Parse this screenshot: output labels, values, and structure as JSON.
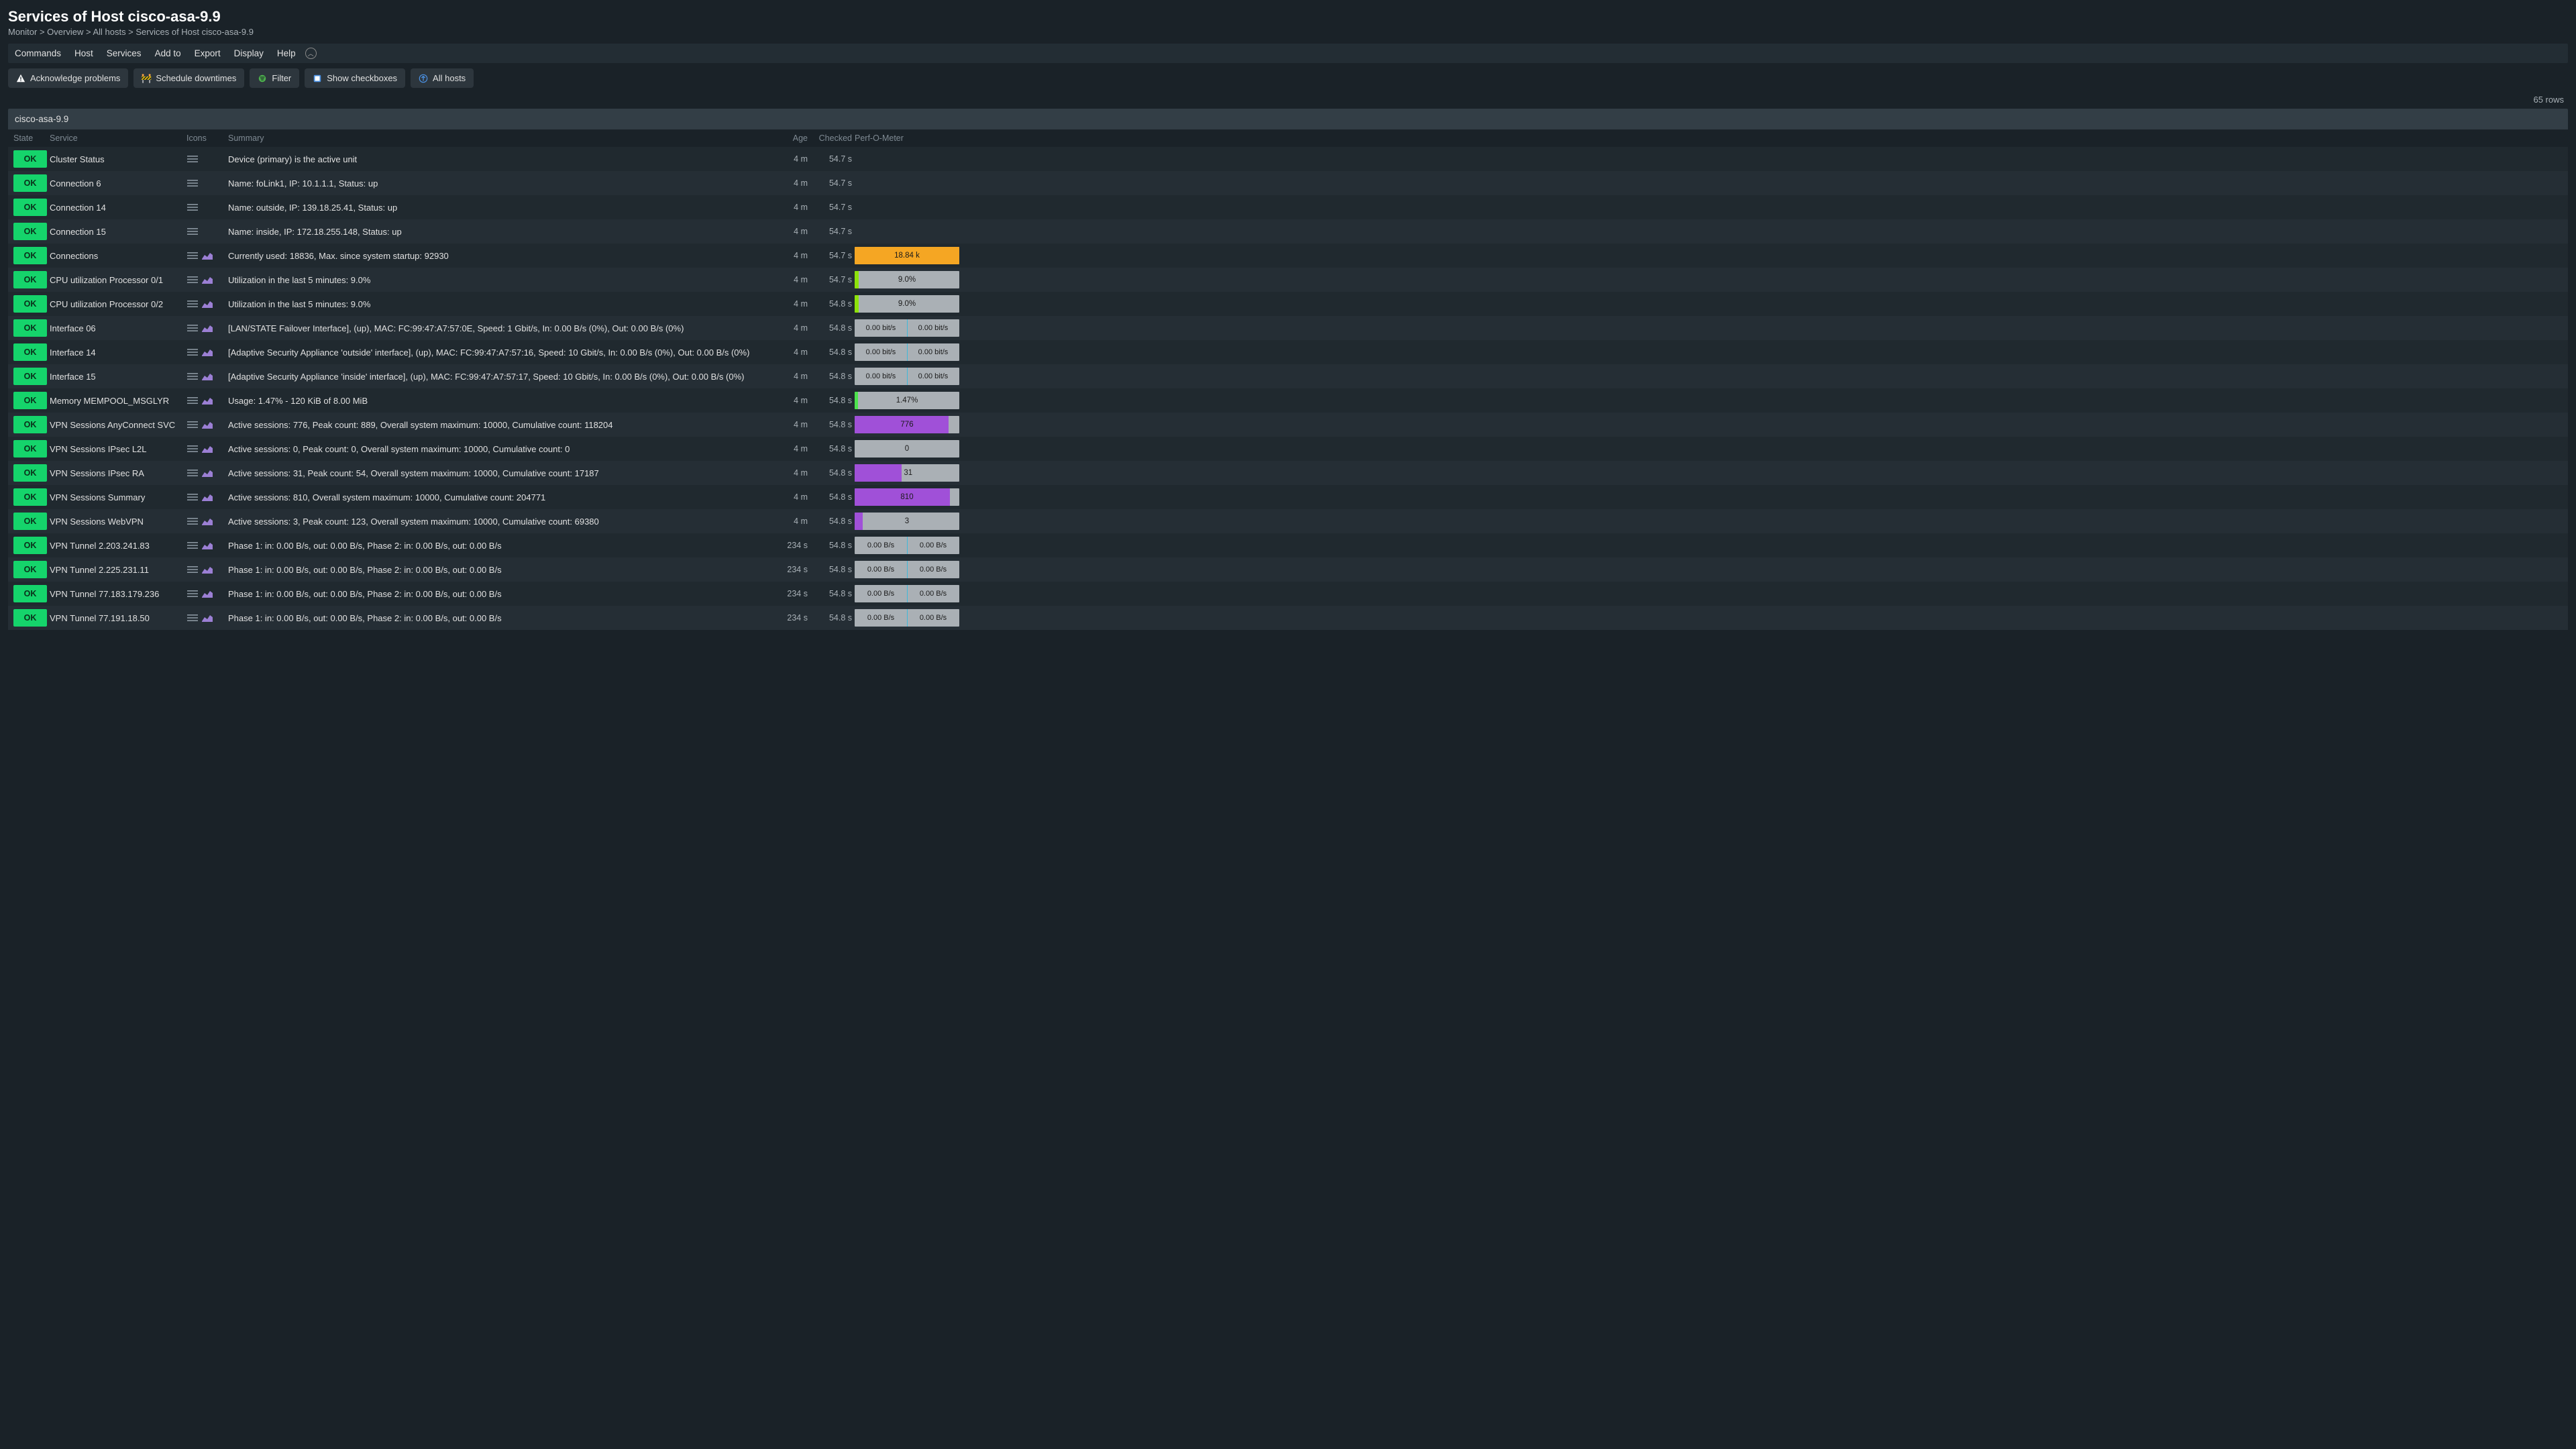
{
  "header": {
    "title": "Services of Host cisco-asa-9.9",
    "breadcrumb": "Monitor > Overview > All hosts > Services of Host cisco-asa-9.9"
  },
  "menubar": [
    "Commands",
    "Host",
    "Services",
    "Add to",
    "Export",
    "Display",
    "Help"
  ],
  "actions": {
    "ack": "Acknowledge problems",
    "downtime": "Schedule downtimes",
    "filter": "Filter",
    "checkboxes": "Show checkboxes",
    "allhosts": "All hosts"
  },
  "rows_label": "65 rows",
  "host_name": "cisco-asa-9.9",
  "columns": {
    "state": "State",
    "service": "Service",
    "icons": "Icons",
    "summary": "Summary",
    "age": "Age",
    "checked": "Checked",
    "perf": "Perf-O-Meter"
  },
  "rows": [
    {
      "state": "OK",
      "service": "Cluster Status",
      "icons": [
        "menu"
      ],
      "summary": "Device (primary) is the active unit",
      "age": "4 m",
      "checked": "54.7 s",
      "perf": null
    },
    {
      "state": "OK",
      "service": "Connection 6",
      "icons": [
        "menu"
      ],
      "summary": "Name: foLink1, IP: 10.1.1.1, Status: up",
      "age": "4 m",
      "checked": "54.7 s",
      "perf": null
    },
    {
      "state": "OK",
      "service": "Connection 14",
      "icons": [
        "menu"
      ],
      "summary": "Name: outside, IP: 139.18.25.41, Status: up",
      "age": "4 m",
      "checked": "54.7 s",
      "perf": null
    },
    {
      "state": "OK",
      "service": "Connection 15",
      "icons": [
        "menu"
      ],
      "summary": "Name: inside, IP: 172.18.255.148, Status: up",
      "age": "4 m",
      "checked": "54.7 s",
      "perf": null
    },
    {
      "state": "OK",
      "service": "Connections",
      "icons": [
        "menu",
        "chart"
      ],
      "summary": "Currently used: 18836, Max. since system startup: 92930",
      "age": "4 m",
      "checked": "54.7 s",
      "perf": {
        "type": "single",
        "label": "18.84 k",
        "fill": 100,
        "color": "orange"
      }
    },
    {
      "state": "OK",
      "service": "CPU utilization Processor 0/1",
      "icons": [
        "menu",
        "chart"
      ],
      "summary": "Utilization in the last 5 minutes: 9.0%",
      "age": "4 m",
      "checked": "54.7 s",
      "perf": {
        "type": "single",
        "label": "9.0%",
        "fill": 4,
        "color": "green"
      }
    },
    {
      "state": "OK",
      "service": "CPU utilization Processor 0/2",
      "icons": [
        "menu",
        "chart"
      ],
      "summary": "Utilization in the last 5 minutes: 9.0%",
      "age": "4 m",
      "checked": "54.8 s",
      "perf": {
        "type": "single",
        "label": "9.0%",
        "fill": 4,
        "color": "green"
      }
    },
    {
      "state": "OK",
      "service": "Interface 06",
      "icons": [
        "menu",
        "chart"
      ],
      "summary": "[LAN/STATE Failover Interface], (up), MAC: FC:99:47:A7:57:0E, Speed: 1 Gbit/s, In: 0.00 B/s (0%), Out: 0.00 B/s (0%)",
      "age": "4 m",
      "checked": "54.8 s",
      "perf": {
        "type": "split",
        "left": "0.00 bit/s",
        "right": "0.00 bit/s",
        "tick": true
      }
    },
    {
      "state": "OK",
      "service": "Interface 14",
      "icons": [
        "menu",
        "chart"
      ],
      "summary": "[Adaptive Security Appliance 'outside' interface], (up), MAC: FC:99:47:A7:57:16, Speed: 10 Gbit/s, In: 0.00 B/s (0%), Out: 0.00 B/s (0%)",
      "age": "4 m",
      "checked": "54.8 s",
      "perf": {
        "type": "split",
        "left": "0.00 bit/s",
        "right": "0.00 bit/s",
        "tick": true
      }
    },
    {
      "state": "OK",
      "service": "Interface 15",
      "icons": [
        "menu",
        "chart"
      ],
      "summary": "[Adaptive Security Appliance 'inside' interface], (up), MAC: FC:99:47:A7:57:17, Speed: 10 Gbit/s, In: 0.00 B/s (0%), Out: 0.00 B/s (0%)",
      "age": "4 m",
      "checked": "54.8 s",
      "perf": {
        "type": "split",
        "left": "0.00 bit/s",
        "right": "0.00 bit/s",
        "tick": true
      }
    },
    {
      "state": "OK",
      "service": "Memory MEMPOOL_MSGLYR",
      "icons": [
        "menu",
        "chart"
      ],
      "summary": "Usage: 1.47% - 120 KiB of 8.00 MiB",
      "age": "4 m",
      "checked": "54.8 s",
      "perf": {
        "type": "single",
        "label": "1.47%",
        "fill": 3,
        "color": "memgreen"
      }
    },
    {
      "state": "OK",
      "service": "VPN Sessions AnyConnect SVC",
      "icons": [
        "menu",
        "chart"
      ],
      "summary": "Active sessions: 776, Peak count: 889, Overall system maximum: 10000, Cumulative count: 118204",
      "age": "4 m",
      "checked": "54.8 s",
      "perf": {
        "type": "single",
        "label": "776",
        "fill": 90,
        "color": "purple"
      }
    },
    {
      "state": "OK",
      "service": "VPN Sessions IPsec L2L",
      "icons": [
        "menu",
        "chart"
      ],
      "summary": "Active sessions: 0, Peak count: 0, Overall system maximum: 10000, Cumulative count: 0",
      "age": "4 m",
      "checked": "54.8 s",
      "perf": {
        "type": "single",
        "label": "0",
        "fill": 0,
        "color": "purple"
      }
    },
    {
      "state": "OK",
      "service": "VPN Sessions IPsec RA",
      "icons": [
        "menu",
        "chart"
      ],
      "summary": "Active sessions: 31, Peak count: 54, Overall system maximum: 10000, Cumulative count: 17187",
      "age": "4 m",
      "checked": "54.8 s",
      "perf": {
        "type": "single",
        "label": "31",
        "fill": 45,
        "color": "purple",
        "labelAlign": "after"
      }
    },
    {
      "state": "OK",
      "service": "VPN Sessions Summary",
      "icons": [
        "menu",
        "chart"
      ],
      "summary": "Active sessions: 810, Overall system maximum: 10000, Cumulative count: 204771",
      "age": "4 m",
      "checked": "54.8 s",
      "perf": {
        "type": "single",
        "label": "810",
        "fill": 91,
        "color": "purple"
      }
    },
    {
      "state": "OK",
      "service": "VPN Sessions WebVPN",
      "icons": [
        "menu",
        "chart"
      ],
      "summary": "Active sessions: 3, Peak count: 123, Overall system maximum: 10000, Cumulative count: 69380",
      "age": "4 m",
      "checked": "54.8 s",
      "perf": {
        "type": "single",
        "label": "3",
        "fill": 8,
        "color": "purple"
      }
    },
    {
      "state": "OK",
      "service": "VPN Tunnel 2.203.241.83",
      "icons": [
        "menu",
        "chart"
      ],
      "summary": "Phase 1: in: 0.00 B/s, out: 0.00 B/s, Phase 2: in: 0.00 B/s, out: 0.00 B/s",
      "age": "234 s",
      "checked": "54.8 s",
      "perf": {
        "type": "split",
        "left": "0.00 B/s",
        "right": "0.00 B/s",
        "tick": true
      }
    },
    {
      "state": "OK",
      "service": "VPN Tunnel 2.225.231.11",
      "icons": [
        "menu",
        "chart"
      ],
      "summary": "Phase 1: in: 0.00 B/s, out: 0.00 B/s, Phase 2: in: 0.00 B/s, out: 0.00 B/s",
      "age": "234 s",
      "checked": "54.8 s",
      "perf": {
        "type": "split",
        "left": "0.00 B/s",
        "right": "0.00 B/s",
        "tick": true
      }
    },
    {
      "state": "OK",
      "service": "VPN Tunnel 77.183.179.236",
      "icons": [
        "menu",
        "chart"
      ],
      "summary": "Phase 1: in: 0.00 B/s, out: 0.00 B/s, Phase 2: in: 0.00 B/s, out: 0.00 B/s",
      "age": "234 s",
      "checked": "54.8 s",
      "perf": {
        "type": "split",
        "left": "0.00 B/s",
        "right": "0.00 B/s",
        "tick": true
      }
    },
    {
      "state": "OK",
      "service": "VPN Tunnel 77.191.18.50",
      "icons": [
        "menu",
        "chart"
      ],
      "summary": "Phase 1: in: 0.00 B/s, out: 0.00 B/s, Phase 2: in: 0.00 B/s, out: 0.00 B/s",
      "age": "234 s",
      "checked": "54.8 s",
      "perf": {
        "type": "split",
        "left": "0.00 B/s",
        "right": "0.00 B/s",
        "tick": true
      }
    }
  ]
}
